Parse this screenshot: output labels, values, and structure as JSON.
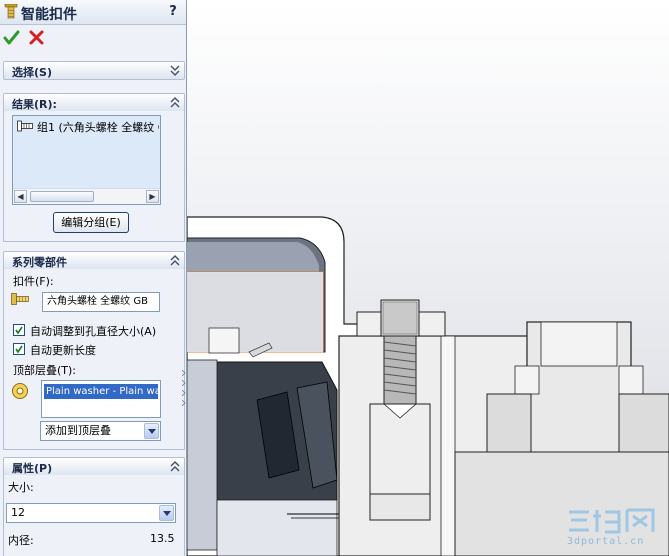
{
  "window": {
    "title": "智能扣件",
    "help": "?"
  },
  "sections": {
    "selection": {
      "title": "选择(S)"
    },
    "results": {
      "title": "结果(R):",
      "items": [
        "组1 (六角头螺栓 全螺纹 GB"
      ],
      "edit_group_label": "编辑分组(E)"
    },
    "series": {
      "title": "系列零部件",
      "fastener_label": "扣件(F):",
      "fastener_value": "六角头螺栓 全螺纹 GB",
      "auto_size_label": "自动调整到孔直径大小(A)",
      "auto_length_label": "自动更新长度",
      "top_stack_label": "顶部层叠(T):",
      "top_stack_item": "Plain washer - Plain was",
      "add_top_stack": "添加到顶层叠"
    },
    "properties": {
      "title": "属性(P)",
      "size_label": "大小:",
      "size_value": "12",
      "inner_diameter_label": "内径:",
      "inner_diameter_value": "13.5"
    }
  },
  "checkboxes": {
    "auto_size_checked": true,
    "auto_length_checked": true
  },
  "watermark": {
    "text": "3dportal.cn"
  },
  "colors": {
    "accent": "#3169c6",
    "ok": "#2e9a2e",
    "cancel": "#d42020",
    "panel_bg": "#eef2f8"
  },
  "icons": [
    "fastener-icon",
    "ok-check-icon",
    "cancel-x-icon",
    "chevron-down-double-icon",
    "chevron-up-double-icon",
    "bolt-icon",
    "washer-icon"
  ]
}
